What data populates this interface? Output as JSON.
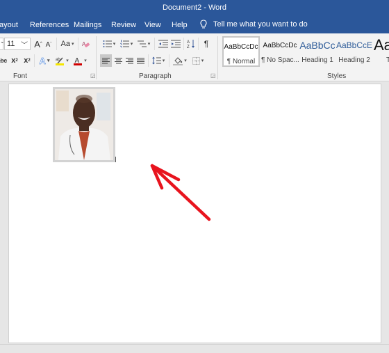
{
  "window": {
    "title": "Document2  -  Word"
  },
  "tabs": [
    {
      "label": "ayout"
    },
    {
      "label": "References"
    },
    {
      "label": "Mailings"
    },
    {
      "label": "Review"
    },
    {
      "label": "View"
    },
    {
      "label": "Help"
    }
  ],
  "tell_me": {
    "placeholder": "Tell me what you want to do",
    "icon": "lightbulb-icon"
  },
  "font_group": {
    "label": "Font",
    "font_size": "11",
    "buttons": {
      "grow": "A",
      "shrink": "A",
      "change_case": "Aa",
      "clear_formatting_icon": "eraser-icon",
      "strikethrough": "abc",
      "subscript": "x",
      "subscript_mark": "2",
      "superscript": "x",
      "superscript_mark": "2",
      "text_effects": "A",
      "highlight": "ab",
      "font_color": "A"
    },
    "highlight_color": "#f5e600",
    "font_color": "#d00000"
  },
  "paragraph_group": {
    "label": "Paragraph",
    "buttons": [
      "bullets",
      "numbering",
      "multilevel-list",
      "decrease-indent",
      "increase-indent",
      "sort",
      "show-formatting",
      "align-left",
      "center",
      "align-right",
      "justify",
      "line-spacing",
      "shading",
      "borders"
    ],
    "pilcrow": "¶",
    "sort_label": "↓"
  },
  "styles_group": {
    "label": "Styles",
    "items": [
      {
        "sample": "AaBbCcDc",
        "name": "¶ Normal",
        "selected": true
      },
      {
        "sample": "AaBbCcDc",
        "name": "¶ No Spac...",
        "selected": false
      },
      {
        "sample": "AaBbCc",
        "name": "Heading 1",
        "selected": false
      },
      {
        "sample": "AaBbCcE",
        "name": "Heading 2",
        "selected": false
      },
      {
        "sample": "Aa",
        "name": "T",
        "selected": false
      }
    ]
  },
  "document": {
    "picture_alt": "Photo of a smiling man in a white doctor's coat with stethoscope",
    "annotation": "red-arrow-pointing-to-picture"
  },
  "colors": {
    "brand": "#2b579a",
    "arrow": "#e8141e"
  }
}
